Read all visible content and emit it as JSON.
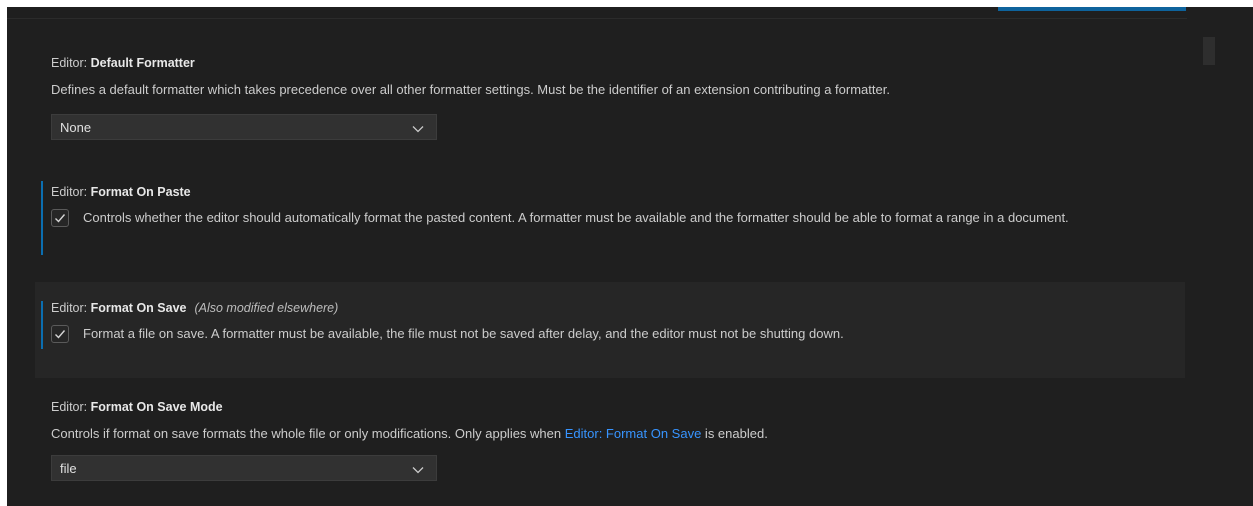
{
  "settings": [
    {
      "category": "Editor: ",
      "name": "Default Formatter",
      "description": "Defines a default formatter which takes precedence over all other formatter settings. Must be the identifier of an extension contributing a formatter.",
      "control": "select",
      "value": "None"
    },
    {
      "category": "Editor: ",
      "name": "Format On Paste",
      "description": "Controls whether the editor should automatically format the pasted content. A formatter must be available and the formatter should be able to format a range in a document.",
      "control": "checkbox",
      "checked": true,
      "modified": true
    },
    {
      "category": "Editor: ",
      "name": "Format On Save",
      "modified_note": "(Also modified elsewhere)",
      "description": "Format a file on save. A formatter must be available, the file must not be saved after delay, and the editor must not be shutting down.",
      "control": "checkbox",
      "checked": true,
      "modified": true
    },
    {
      "category": "Editor: ",
      "name": "Format On Save Mode",
      "description_before": "Controls if format on save formats the whole file or only modifications. Only applies when ",
      "description_link": "Editor: Format On Save",
      "description_after": " is enabled.",
      "control": "select",
      "value": "file"
    }
  ],
  "colors": {
    "background": "#1f1f1f",
    "hover_row": "#262626",
    "modified_indicator": "#0b6eb0",
    "link": "#3794ff",
    "accent": "#0e639c"
  },
  "icons": {
    "dropdown": "chevron-down-icon",
    "check": "check-icon"
  }
}
